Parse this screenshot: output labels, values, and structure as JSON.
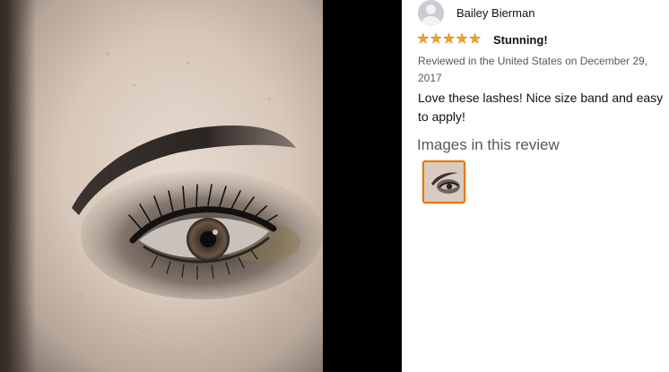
{
  "photo": {
    "alt": "eye-makeup-photo"
  },
  "review": {
    "reviewer_name": "Bailey Bierman",
    "rating": 5,
    "rating_max": 5,
    "title": "Stunning!",
    "meta": "Reviewed in the United States on December 29, 2017",
    "body": "Love these lashes! Nice size band and easy to apply!",
    "images_heading": "Images in this review"
  },
  "colors": {
    "star": "#f4a41d",
    "thumb_border": "#e77600",
    "meta_text": "#565959"
  }
}
